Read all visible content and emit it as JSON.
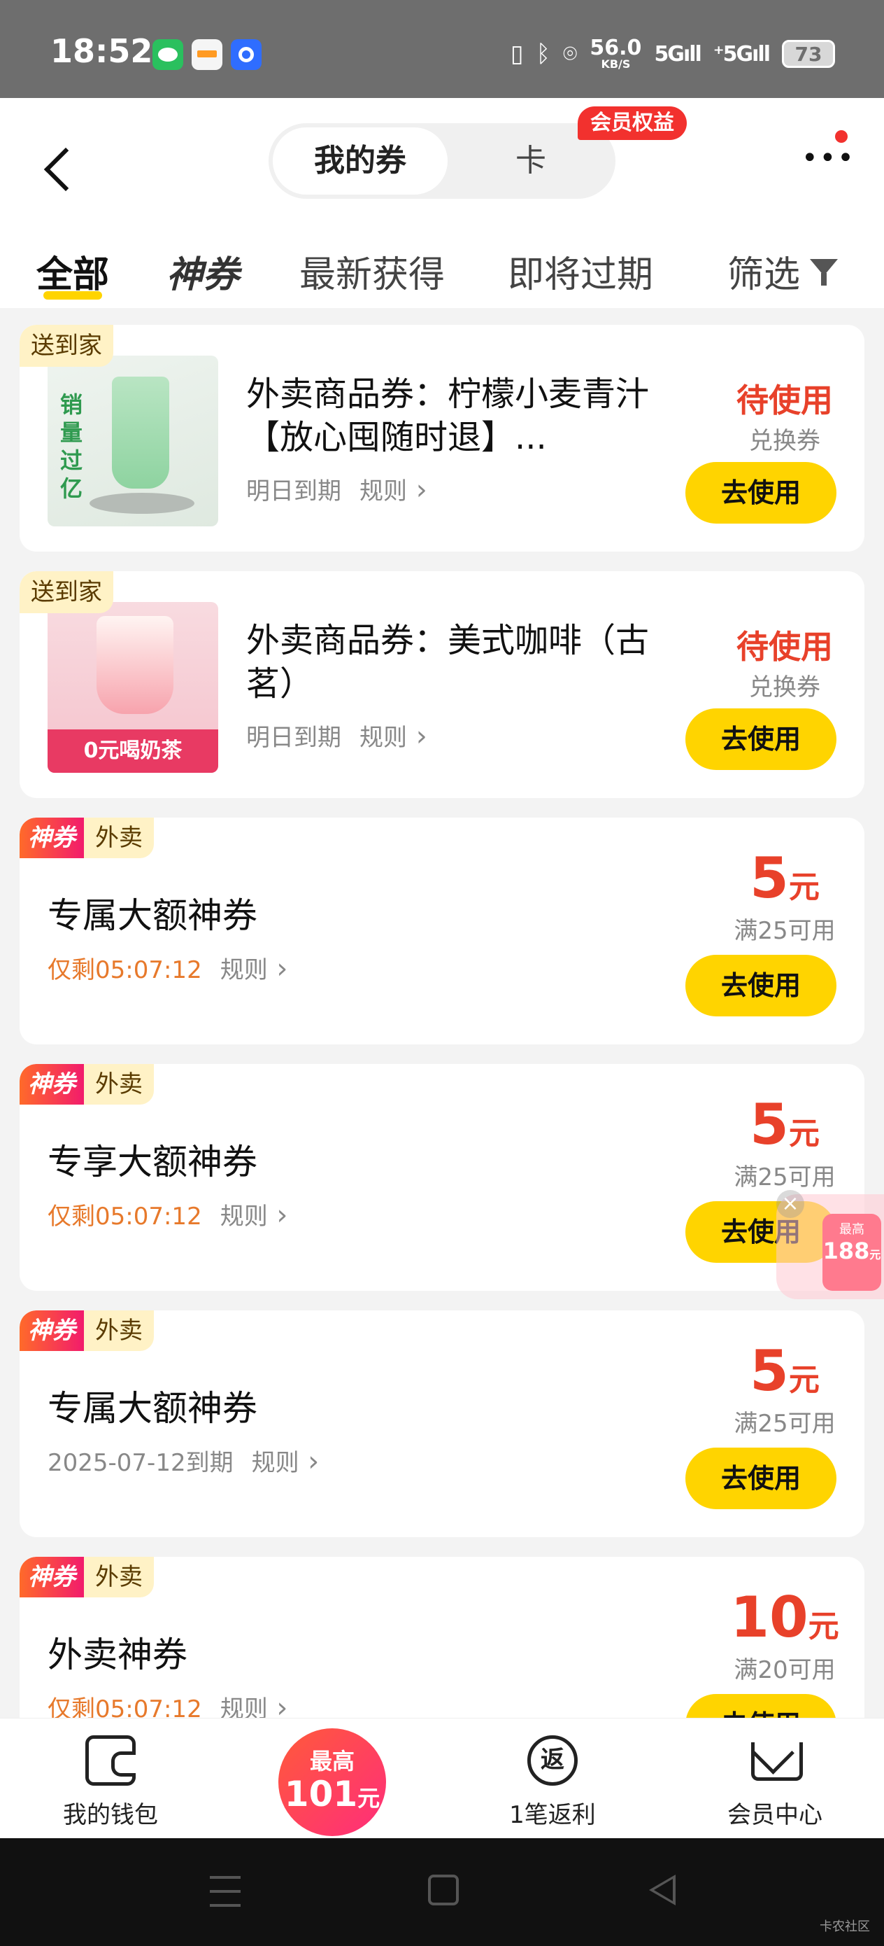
{
  "status_bar": {
    "time": "18:52",
    "net_speed": "56.0",
    "net_unit": "KB/S",
    "signal1": "5G",
    "signal2": "⁺5G",
    "battery": "73"
  },
  "header": {
    "seg_active": "我的券",
    "seg_inactive": "卡",
    "member_badge": "会员权益"
  },
  "tabs": {
    "all": "全部",
    "shenquan": "神券",
    "newest": "最新获得",
    "expiring": "即将过期",
    "filter": "筛选"
  },
  "coupons": [
    {
      "tag": "送到家",
      "title": "外卖商品券：柠檬小麦青汁【放心囤随时退】...",
      "expiry": "明日到期",
      "rule": "规则",
      "status": "待使用",
      "type": "兑换券",
      "button": "去使用",
      "img_text": "销量过亿"
    },
    {
      "tag": "送到家",
      "title": "外卖商品券：美式咖啡（古茗）",
      "expiry": "明日到期",
      "rule": "规则",
      "status": "待使用",
      "type": "兑换券",
      "button": "去使用",
      "img_text": "0元喝奶茶"
    },
    {
      "tag1": "神券",
      "tag2": "外卖",
      "title": "专属大额神券",
      "expiry": "仅剩05:07:12",
      "rule": "规则",
      "amount": "5",
      "unit": "元",
      "condition": "满25可用",
      "button": "去使用"
    },
    {
      "tag1": "神券",
      "tag2": "外卖",
      "title": "专享大额神券",
      "expiry": "仅剩05:07:12",
      "rule": "规则",
      "amount": "5",
      "unit": "元",
      "condition": "满25可用",
      "button": "去使用"
    },
    {
      "tag1": "神券",
      "tag2": "外卖",
      "title": "专属大额神券",
      "expiry": "2025-07-12到期",
      "rule": "规则",
      "amount": "5",
      "unit": "元",
      "condition": "满25可用",
      "button": "去使用"
    },
    {
      "tag1": "神券",
      "tag2": "外卖",
      "title": "外卖神券",
      "expiry": "仅剩05:07:12",
      "rule": "规则",
      "amount": "10",
      "unit": "元",
      "condition": "满20可用",
      "button": "去使用"
    }
  ],
  "float_widget": {
    "top_text": "最高",
    "amount": "188",
    "unit": "元"
  },
  "bottom_nav": {
    "wallet": "我的钱包",
    "promo_top": "最高",
    "promo_amount": "101",
    "promo_unit": "元",
    "rebate_icon": "返",
    "rebate": "1笔返利",
    "member": "会员中心"
  },
  "watermark": "卡农社区"
}
